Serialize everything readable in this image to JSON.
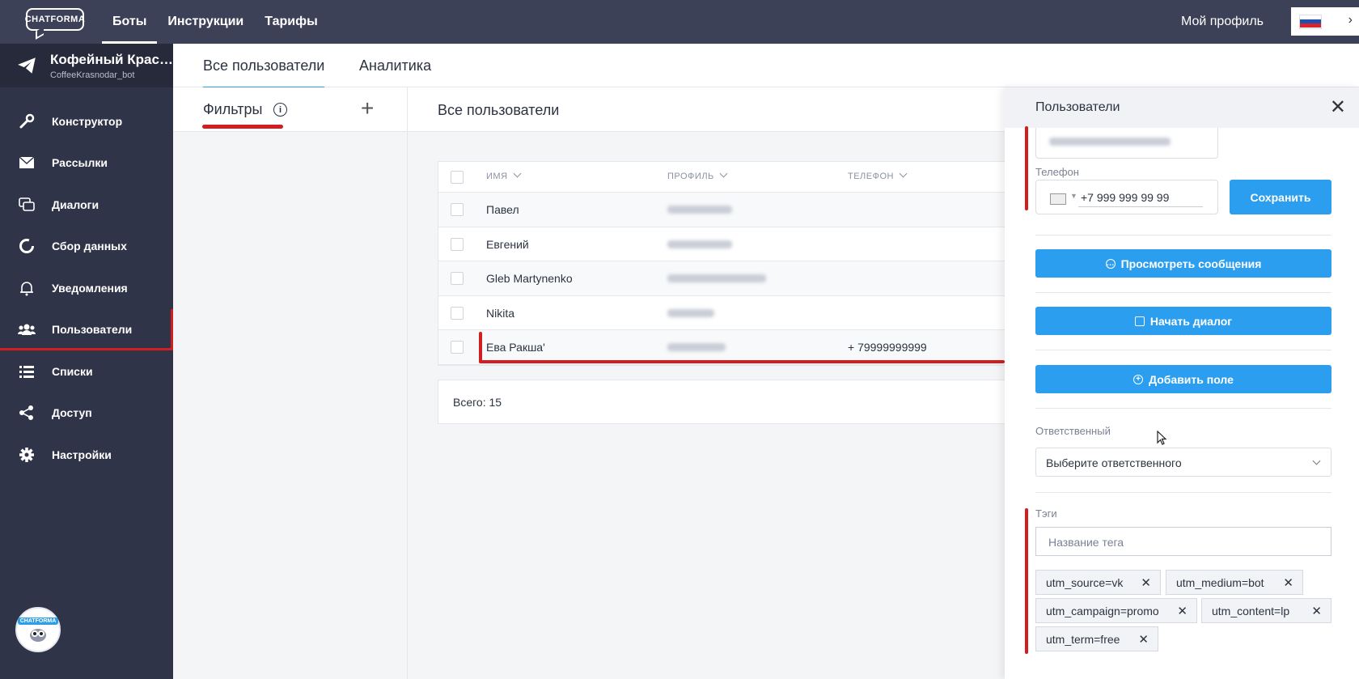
{
  "topbar": {
    "logo_text": "CHATFORMA",
    "nav": [
      "Боты",
      "Инструкции",
      "Тарифы"
    ],
    "profile_label": "Мой профиль",
    "language_flag": "ru-flag"
  },
  "sidebar": {
    "bot_name": "Кофейный Крас…",
    "bot_handle": "CoffeeKrasnodar_bot",
    "items": [
      {
        "label": "Конструктор",
        "icon": "wrench-icon"
      },
      {
        "label": "Рассылки",
        "icon": "envelope-icon"
      },
      {
        "label": "Диалоги",
        "icon": "chat-icon"
      },
      {
        "label": "Сбор данных",
        "icon": "circle-progress-icon"
      },
      {
        "label": "Уведомления",
        "icon": "bell-icon"
      },
      {
        "label": "Пользователи",
        "icon": "users-icon"
      },
      {
        "label": "Списки",
        "icon": "list-icon"
      },
      {
        "label": "Доступ",
        "icon": "share-icon"
      },
      {
        "label": "Настройки",
        "icon": "gear-icon"
      }
    ],
    "avatar_label": "CHATFORMA"
  },
  "tabs": {
    "all_users": "Все пользователи",
    "analytics": "Аналитика"
  },
  "filters": {
    "title": "Фильтры",
    "info": "i",
    "add": "+"
  },
  "content": {
    "title": "Все пользователи",
    "table": {
      "headers": [
        "ИМЯ",
        "ПРОФИЛЬ",
        "ТЕЛЕФОН"
      ],
      "rows": [
        {
          "name": "Павел",
          "phone": ""
        },
        {
          "name": "Евгений",
          "phone": ""
        },
        {
          "name": "Gleb Martynenko",
          "phone": ""
        },
        {
          "name": "Nikita",
          "phone": ""
        },
        {
          "name": "Ева Ракша'",
          "phone": "+ 79999999999"
        }
      ]
    },
    "total": "Всего: 15"
  },
  "panel": {
    "title": "Пользователи",
    "phone_label": "Телефон",
    "phone_value": "+7 999 999 99 99",
    "save": "Сохранить",
    "view_messages": "Просмотреть сообщения",
    "start_dialog": "Начать диалог",
    "add_field": "Добавить поле",
    "responsible_label": "Ответственный",
    "responsible_placeholder": "Выберите ответственного",
    "tags_label": "Тэги",
    "tag_placeholder": "Название тега",
    "tags": [
      "utm_source=vk",
      "utm_medium=bot",
      "utm_campaign=promo",
      "utm_content=lp",
      "utm_term=free"
    ]
  },
  "colors": {
    "accent": "#2b9ef0",
    "sidebar": "#303448",
    "topbar": "#3d4157",
    "highlight": "#d21e1e"
  }
}
